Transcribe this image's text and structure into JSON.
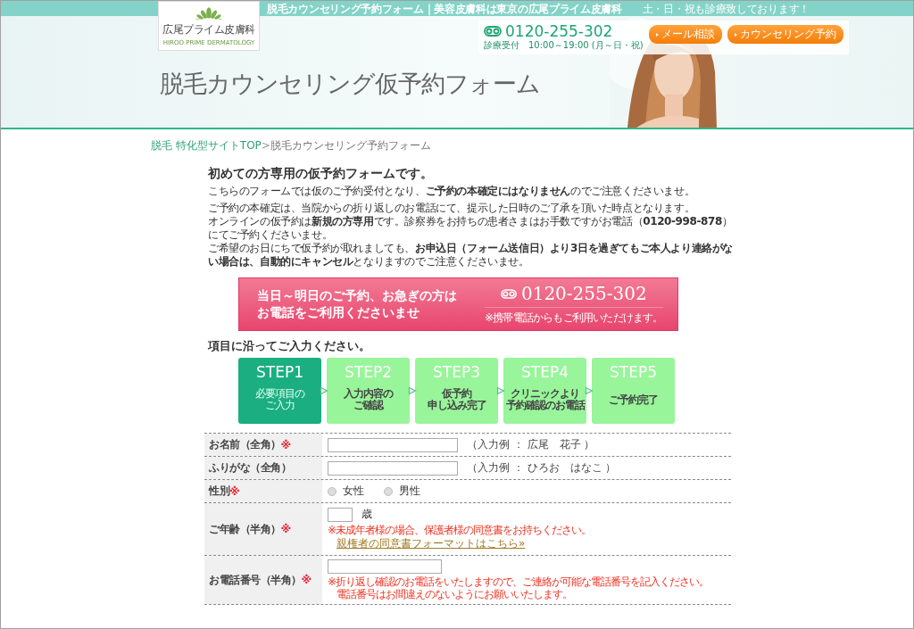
{
  "header": {
    "tagline": "脱毛カウンセリング予約フォーム｜美容皮膚科は東京の広尾プライム皮膚科",
    "notice": "土・日・祝も診療致しております！",
    "logo": {
      "name": "広尾プライム皮膚科",
      "sub": "HIROO PRIME DERMATOLOGY"
    },
    "phone": "0120-255-302",
    "hours": "診療受付　10:00～19:00 (月～日・祝)",
    "buttons": [
      "メール相談",
      "カウンセリング予約"
    ],
    "page_title": "脱毛カウンセリング仮予約フォーム",
    "photo": {
      "kind": "picture"
    }
  },
  "breadcrumb": [
    {
      "label": "脱毛 特化型サイトTOP",
      "kind": "link"
    },
    {
      "label": ">",
      "kind": "separator"
    },
    {
      "label": "脱毛カウンセリング予約フォーム",
      "kind": "current"
    }
  ],
  "intro": {
    "heading": "初めての方専用の仮予約フォームです。",
    "paragraphs": [
      {
        "lines": [
          "こちらのフォームでは仮のご予約受付となり、**ご予約の本確定にはなりません**のでご注意くださいませ。"
        ]
      },
      {
        "lines": [
          "ご予約の本確定は、当院からの折り返しのお電話にて、提示した日時のご了承を頂いた時点となります。",
          "オンラインの仮予約は**新規の方専用**です。診察券をお持ちの患者さまはお手数ですがお電話（**0120-998-878**）にてご予約くださいませ。",
          "ご希望のお日にちで仮予約が取れましても、**お申込日（フォーム送信日）より3日を過ぎてもご本人より連絡がない場合は、自動的にキャンセル**となりますのでご注意くださいませ。"
        ]
      }
    ]
  },
  "call_banner": {
    "message": [
      "当日～明日のご予約、お急ぎの方は",
      "お電話をご利用くださいませ"
    ],
    "phone": "0120-255-302",
    "note": "※携帯電話からもご利用いただけます。"
  },
  "steps_heading": "項目に沿ってご入力ください。",
  "steps": [
    {
      "label": "STEP1",
      "caption": [
        "必要項目の",
        "ご入力"
      ],
      "selected": true
    },
    {
      "label": "STEP2",
      "caption": [
        "入力内容の",
        "ご確認"
      ],
      "selected": false
    },
    {
      "label": "STEP3",
      "caption": [
        "仮予約",
        "申し込み完了"
      ],
      "selected": false
    },
    {
      "label": "STEP4",
      "caption": [
        "クリニックより",
        "予約確認のお電話"
      ],
      "selected": false
    },
    {
      "label": "STEP5",
      "caption": [
        "ご予約完了"
      ],
      "selected": false
    }
  ],
  "required_mark": "※",
  "form": [
    {
      "label": "お名前（全角）",
      "required": true,
      "kind": "text",
      "example": "（入力例 ： 広尾　花子 ）"
    },
    {
      "label": "ふりがな（全角）",
      "required": false,
      "kind": "text",
      "example": "（入力例 ： ひろお　はなこ ）"
    },
    {
      "label": "性別",
      "required": true,
      "kind": "radio",
      "options": [
        {
          "label": "女性",
          "selected": false
        },
        {
          "label": "男性",
          "selected": false
        }
      ]
    },
    {
      "label": "ご年齢（半角）",
      "required": true,
      "kind": "age",
      "unit": "歳",
      "notes": [
        "※未成年者様の場合、保護者様の同意書をお持ちください。"
      ],
      "link": "親権者の同意書フォーマットはこちら»"
    },
    {
      "label": "お電話番号（半角）",
      "required": true,
      "kind": "tel",
      "notes": [
        "※折り返し確認のお電話をいたしますので、ご連絡が可能な電話番号を記入ください。",
        "電話番号はお間違えのないようにお願いいたします。"
      ]
    }
  ]
}
